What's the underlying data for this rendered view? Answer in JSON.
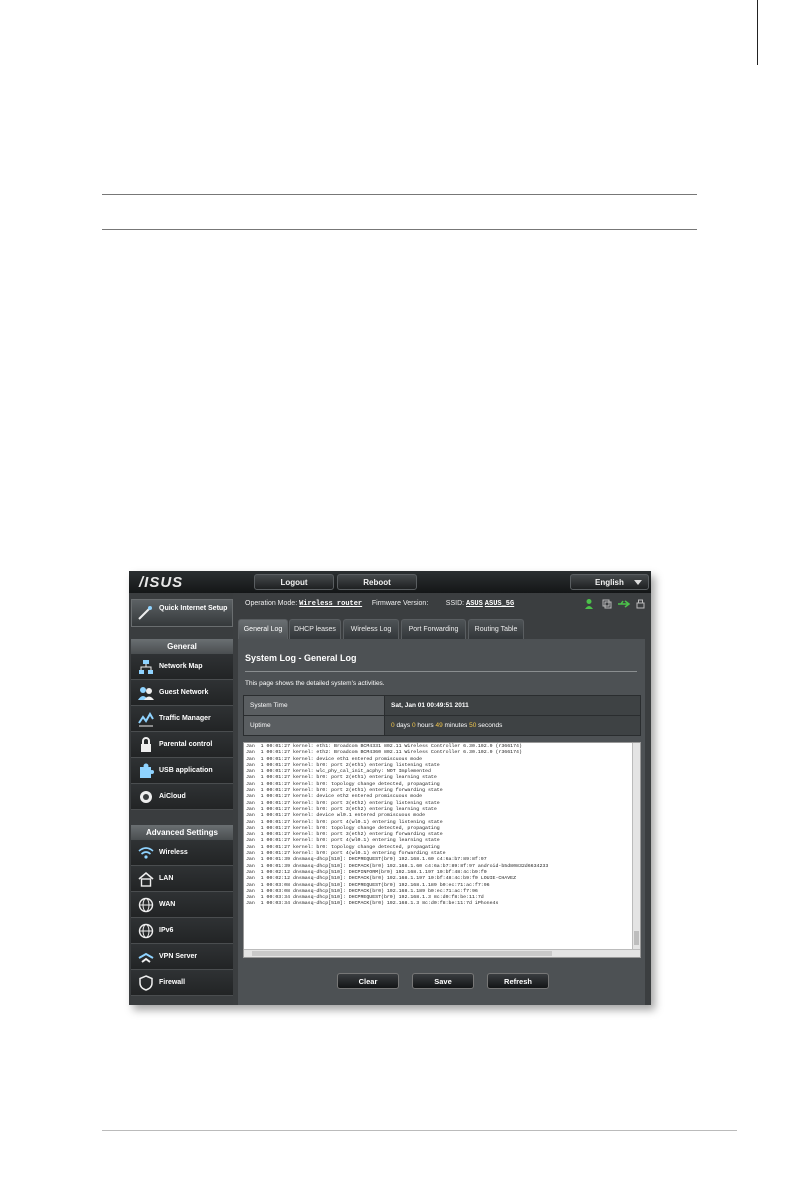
{
  "topbar": {
    "logo": "/ISUS",
    "logout_label": "Logout",
    "reboot_label": "Reboot",
    "language": "English"
  },
  "header": {
    "operation_mode_label": "Operation Mode:",
    "operation_mode_value": "Wireless router",
    "firmware_label": "Firmware Version:",
    "firmware_value": "",
    "ssid_label": "SSID:",
    "ssid_1": "ASUS",
    "ssid_2": "ASUS_5G"
  },
  "sidebar": {
    "quick_setup": "Quick Internet Setup",
    "general_header": "General",
    "general_items": [
      "Network Map",
      "Guest Network",
      "Traffic Manager",
      "Parental control",
      "USB application",
      "AiCloud"
    ],
    "advanced_header": "Advanced Settings",
    "advanced_items": [
      "Wireless",
      "LAN",
      "WAN",
      "IPv6",
      "VPN Server",
      "Firewall"
    ]
  },
  "tabs": [
    "General Log",
    "DHCP leases",
    "Wireless Log",
    "Port Forwarding",
    "Routing Table"
  ],
  "panel": {
    "title": "System Log - General Log",
    "description": "This page shows the detailed system's activities.",
    "system_time_label": "System Time",
    "system_time_value": "Sat, Jan 01  00:49:51  2011",
    "uptime_label": "Uptime",
    "uptime": {
      "days": "0",
      "days_label": "days",
      "hours": "0",
      "hours_label": "hours",
      "minutes": "49",
      "minutes_label": "minutes",
      "seconds": "50",
      "seconds_label": "seconds"
    }
  },
  "log_text": "Jan  1 00:01:27 kernel: eth1: Broadcom BCM4331 802.11 Wireless Controller 6.30.102.9 (r366174)\nJan  1 00:01:27 kernel: eth2: Broadcom BCM4360 802.11 Wireless Controller 6.30.102.9 (r366174)\nJan  1 00:01:27 kernel: device eth1 entered promiscuous mode\nJan  1 00:01:27 kernel: br0: port 2(eth1) entering listening state\nJan  1 00:01:27 kernel: wlc_phy_cal_init_acphy: NOT Implemented\nJan  1 00:01:27 kernel: br0: port 2(eth1) entering learning state\nJan  1 00:01:27 kernel: br0: topology change detected, propagating\nJan  1 00:01:27 kernel: br0: port 2(eth1) entering forwarding state\nJan  1 00:01:27 kernel: device eth2 entered promiscuous mode\nJan  1 00:01:27 kernel: br0: port 3(eth2) entering listening state\nJan  1 00:01:27 kernel: br0: port 3(eth2) entering learning state\nJan  1 00:01:27 kernel: device wl0.1 entered promiscuous mode\nJan  1 00:01:27 kernel: br0: port 4(wl0.1) entering listening state\nJan  1 00:01:27 kernel: br0: topology change detected, propagating\nJan  1 00:01:27 kernel: br0: port 3(eth2) entering forwarding state\nJan  1 00:01:27 kernel: br0: port 4(wl0.1) entering learning state\nJan  1 00:01:27 kernel: br0: topology change detected, propagating\nJan  1 00:01:27 kernel: br0: port 4(wl0.1) entering forwarding state\nJan  1 00:01:39 dnsmasq-dhcp[510]: DHCPREQUEST(br0) 192.168.1.60 c4:6a:b7:89:8f:97\nJan  1 00:01:39 dnsmasq-dhcp[510]: DHCPACK(br0) 192.168.1.60 c4:6a:b7:89:8f:97 android-b5d80832d6634233\nJan  1 00:02:12 dnsmasq-dhcp[510]: DHCPINFORM(br0) 192.168.1.197 10:bf:48:4c:b9:f0\nJan  1 00:02:12 dnsmasq-dhcp[510]: DHCPACK(br0) 192.168.1.197 10:bf:48:4c:b9:f0 LOUIE-CHAVEZ\nJan  1 00:03:08 dnsmasq-dhcp[510]: DHCPREQUEST(br0) 192.168.1.189 b0:ec:71:ac:f7:96\nJan  1 00:03:08 dnsmasq-dhcp[510]: DHCPACK(br0) 192.168.1.189 b0:ec:71:ac:f7:96\nJan  1 00:03:34 dnsmasq-dhcp[510]: DHCPREQUEST(br0) 192.168.1.3 8c:d0:f8:be:11:7d\nJan  1 00:03:34 dnsmasq-dhcp[510]: DHCPACK(br0) 192.168.1.3 8c:d0:f8:be:11:7d iPhone4s",
  "actions": {
    "clear": "Clear",
    "save": "Save",
    "refresh": "Refresh"
  },
  "icons": {
    "quick_setup": "magic-wand-icon",
    "network_map": "network-icon",
    "guest": "people-icon",
    "traffic": "chart-icon",
    "parental": "lock-icon",
    "usb": "puzzle-icon",
    "aicloud": "cloud-icon",
    "wireless": "wifi-icon",
    "lan": "house-icon",
    "wan": "globe-icon",
    "ipv6": "globe-icon",
    "vpn": "vpn-icon",
    "firewall": "shield-icon"
  },
  "colors": {
    "accent": "#f2c64b",
    "status_green": "#4cc24a",
    "background": "#3b3e40"
  }
}
